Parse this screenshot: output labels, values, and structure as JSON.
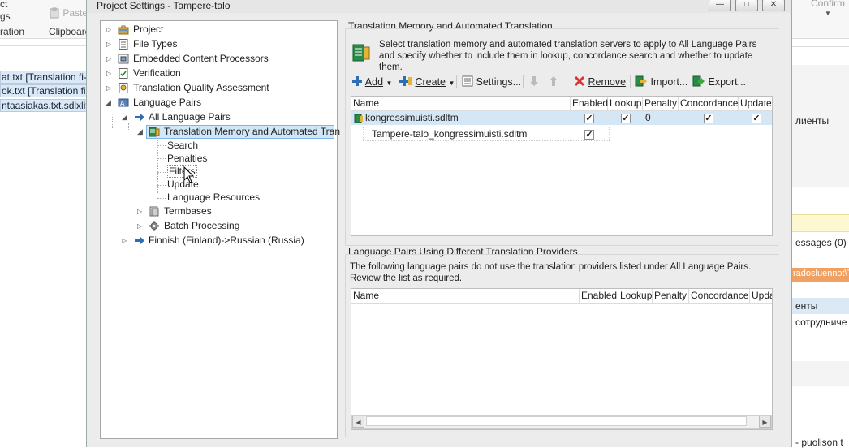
{
  "background_app": {
    "ribbon_left": [
      "ct",
      "gs",
      "ration"
    ],
    "paste_label": "Paste",
    "clipboard_label": "Clipboard",
    "files": [
      "at.txt [Translation fi-F",
      "ok.txt [Translation fi-F",
      "ntaasiakas.txt.sdlxlif"
    ],
    "confirm_label": "Confirm",
    "right_texts": {
      "clients": "лиенты",
      "messages": "essages (0)",
      "path": "radosluennot\\T",
      "clients2": "енты",
      "employee": "сотрудниче",
      "bottom": "- puolison t"
    }
  },
  "dialog": {
    "title": "Project Settings - Tampere-talo",
    "minimize": "—",
    "maximize": "□",
    "close": "✕"
  },
  "tree": {
    "project": "Project",
    "file_types": "File Types",
    "embedded": "Embedded Content Processors",
    "verification": "Verification",
    "tqa": "Translation Quality Assessment",
    "language_pairs": "Language Pairs",
    "all_pairs": "All Language Pairs",
    "tm": "Translation Memory and Automated Tran",
    "search": "Search",
    "penalties": "Penalties",
    "filters": "Filters",
    "update": "Update",
    "lang_resources": "Language Resources",
    "termbases": "Termbases",
    "batch": "Batch Processing",
    "finnish_russian": "Finnish (Finland)->Russian (Russia)"
  },
  "tm_section": {
    "title": "Translation Memory and Automated Translation",
    "description": "Select translation memory and automated translation servers to apply to All Language Pairs and specify whether to include them in lookup, concordance search and whether to update them.",
    "toolbar": {
      "add": "Add",
      "create": "Create",
      "settings": "Settings...",
      "remove": "Remove",
      "import": "Import...",
      "export": "Export..."
    },
    "columns": [
      "Name",
      "Enabled",
      "Lookup",
      "Penalty",
      "Concordance",
      "Update"
    ],
    "rows": [
      {
        "name": "kongressimuisti.sdltm",
        "enabled": true,
        "lookup": true,
        "penalty": "0",
        "concordance": true,
        "update": true
      },
      {
        "name": "Tampere-talo_kongressimuisti.sdltm",
        "enabled": true
      }
    ]
  },
  "lp_section": {
    "title": "Language Pairs Using Different Translation Providers",
    "description": "The following language pairs do not use the translation providers listed under All Language Pairs. Review the list as required.",
    "columns": [
      "Name",
      "Enabled",
      "Lookup",
      "Penalty",
      "Concordance",
      "Upda"
    ]
  },
  "colors": {
    "selection": "#d1e6f6",
    "selection_border": "#7eb4ea",
    "dialog_bg": "#ececec",
    "accent_blue": "#2d6db4"
  }
}
